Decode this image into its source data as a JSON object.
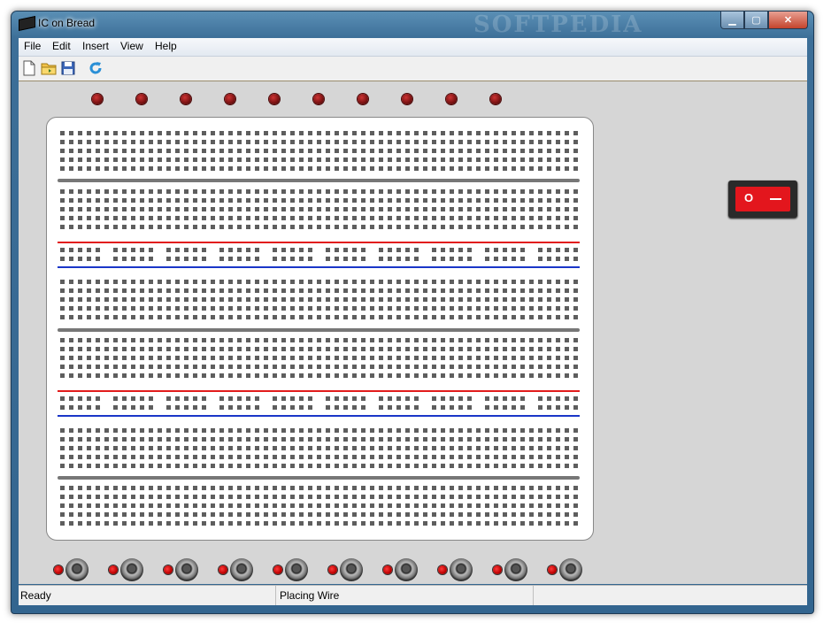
{
  "window": {
    "title": "IC on Bread",
    "watermark": "SOFTPEDIA",
    "minimize_glyph": "▁",
    "maximize_glyph": "▢",
    "close_glyph": "✕"
  },
  "menu": [
    "File",
    "Edit",
    "Insert",
    "View",
    "Help"
  ],
  "toolbar": [
    {
      "name": "new-file-icon"
    },
    {
      "name": "open-folder-icon"
    },
    {
      "name": "save-disk-icon"
    },
    {
      "name": "refresh-icon"
    }
  ],
  "board": {
    "led_count": 10,
    "switch_count": 10
  },
  "power_switch": {
    "on_label": "O"
  },
  "status": {
    "left": "Ready",
    "middle": "Placing Wire",
    "right": ""
  },
  "colors": {
    "rail_positive": "#e21c1c",
    "rail_negative": "#1a36c8",
    "led_off": "#801414",
    "switch_accent": "#e3161d"
  }
}
